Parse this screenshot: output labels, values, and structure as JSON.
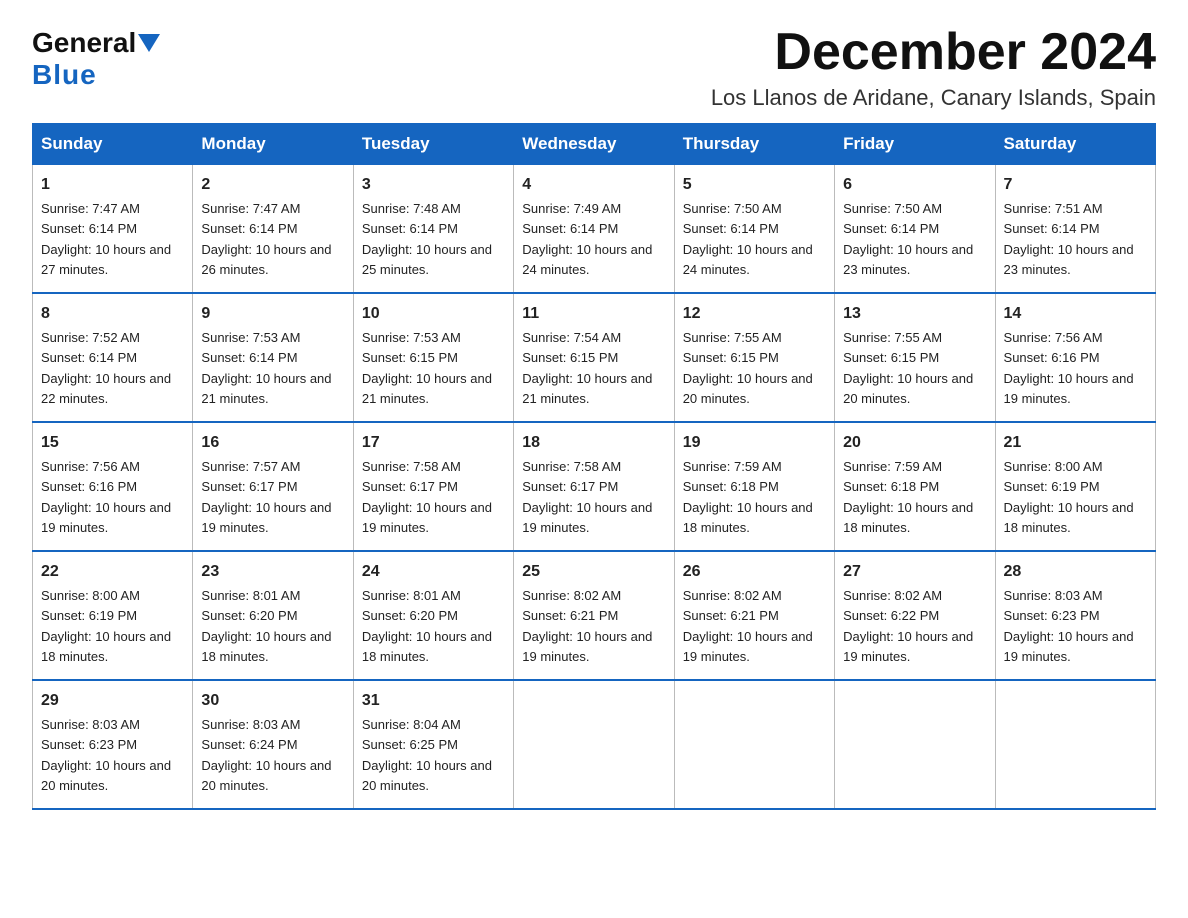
{
  "header": {
    "logo_line1": "General",
    "logo_line2": "Blue",
    "month_title": "December 2024",
    "location": "Los Llanos de Aridane, Canary Islands, Spain"
  },
  "days_of_week": [
    "Sunday",
    "Monday",
    "Tuesday",
    "Wednesday",
    "Thursday",
    "Friday",
    "Saturday"
  ],
  "weeks": [
    [
      {
        "day": "1",
        "sunrise": "7:47 AM",
        "sunset": "6:14 PM",
        "daylight": "10 hours and 27 minutes."
      },
      {
        "day": "2",
        "sunrise": "7:47 AM",
        "sunset": "6:14 PM",
        "daylight": "10 hours and 26 minutes."
      },
      {
        "day": "3",
        "sunrise": "7:48 AM",
        "sunset": "6:14 PM",
        "daylight": "10 hours and 25 minutes."
      },
      {
        "day": "4",
        "sunrise": "7:49 AM",
        "sunset": "6:14 PM",
        "daylight": "10 hours and 24 minutes."
      },
      {
        "day": "5",
        "sunrise": "7:50 AM",
        "sunset": "6:14 PM",
        "daylight": "10 hours and 24 minutes."
      },
      {
        "day": "6",
        "sunrise": "7:50 AM",
        "sunset": "6:14 PM",
        "daylight": "10 hours and 23 minutes."
      },
      {
        "day": "7",
        "sunrise": "7:51 AM",
        "sunset": "6:14 PM",
        "daylight": "10 hours and 23 minutes."
      }
    ],
    [
      {
        "day": "8",
        "sunrise": "7:52 AM",
        "sunset": "6:14 PM",
        "daylight": "10 hours and 22 minutes."
      },
      {
        "day": "9",
        "sunrise": "7:53 AM",
        "sunset": "6:14 PM",
        "daylight": "10 hours and 21 minutes."
      },
      {
        "day": "10",
        "sunrise": "7:53 AM",
        "sunset": "6:15 PM",
        "daylight": "10 hours and 21 minutes."
      },
      {
        "day": "11",
        "sunrise": "7:54 AM",
        "sunset": "6:15 PM",
        "daylight": "10 hours and 21 minutes."
      },
      {
        "day": "12",
        "sunrise": "7:55 AM",
        "sunset": "6:15 PM",
        "daylight": "10 hours and 20 minutes."
      },
      {
        "day": "13",
        "sunrise": "7:55 AM",
        "sunset": "6:15 PM",
        "daylight": "10 hours and 20 minutes."
      },
      {
        "day": "14",
        "sunrise": "7:56 AM",
        "sunset": "6:16 PM",
        "daylight": "10 hours and 19 minutes."
      }
    ],
    [
      {
        "day": "15",
        "sunrise": "7:56 AM",
        "sunset": "6:16 PM",
        "daylight": "10 hours and 19 minutes."
      },
      {
        "day": "16",
        "sunrise": "7:57 AM",
        "sunset": "6:17 PM",
        "daylight": "10 hours and 19 minutes."
      },
      {
        "day": "17",
        "sunrise": "7:58 AM",
        "sunset": "6:17 PM",
        "daylight": "10 hours and 19 minutes."
      },
      {
        "day": "18",
        "sunrise": "7:58 AM",
        "sunset": "6:17 PM",
        "daylight": "10 hours and 19 minutes."
      },
      {
        "day": "19",
        "sunrise": "7:59 AM",
        "sunset": "6:18 PM",
        "daylight": "10 hours and 18 minutes."
      },
      {
        "day": "20",
        "sunrise": "7:59 AM",
        "sunset": "6:18 PM",
        "daylight": "10 hours and 18 minutes."
      },
      {
        "day": "21",
        "sunrise": "8:00 AM",
        "sunset": "6:19 PM",
        "daylight": "10 hours and 18 minutes."
      }
    ],
    [
      {
        "day": "22",
        "sunrise": "8:00 AM",
        "sunset": "6:19 PM",
        "daylight": "10 hours and 18 minutes."
      },
      {
        "day": "23",
        "sunrise": "8:01 AM",
        "sunset": "6:20 PM",
        "daylight": "10 hours and 18 minutes."
      },
      {
        "day": "24",
        "sunrise": "8:01 AM",
        "sunset": "6:20 PM",
        "daylight": "10 hours and 18 minutes."
      },
      {
        "day": "25",
        "sunrise": "8:02 AM",
        "sunset": "6:21 PM",
        "daylight": "10 hours and 19 minutes."
      },
      {
        "day": "26",
        "sunrise": "8:02 AM",
        "sunset": "6:21 PM",
        "daylight": "10 hours and 19 minutes."
      },
      {
        "day": "27",
        "sunrise": "8:02 AM",
        "sunset": "6:22 PM",
        "daylight": "10 hours and 19 minutes."
      },
      {
        "day": "28",
        "sunrise": "8:03 AM",
        "sunset": "6:23 PM",
        "daylight": "10 hours and 19 minutes."
      }
    ],
    [
      {
        "day": "29",
        "sunrise": "8:03 AM",
        "sunset": "6:23 PM",
        "daylight": "10 hours and 20 minutes."
      },
      {
        "day": "30",
        "sunrise": "8:03 AM",
        "sunset": "6:24 PM",
        "daylight": "10 hours and 20 minutes."
      },
      {
        "day": "31",
        "sunrise": "8:04 AM",
        "sunset": "6:25 PM",
        "daylight": "10 hours and 20 minutes."
      },
      null,
      null,
      null,
      null
    ]
  ],
  "labels": {
    "sunrise_prefix": "Sunrise: ",
    "sunset_prefix": "Sunset: ",
    "daylight_prefix": "Daylight: "
  }
}
